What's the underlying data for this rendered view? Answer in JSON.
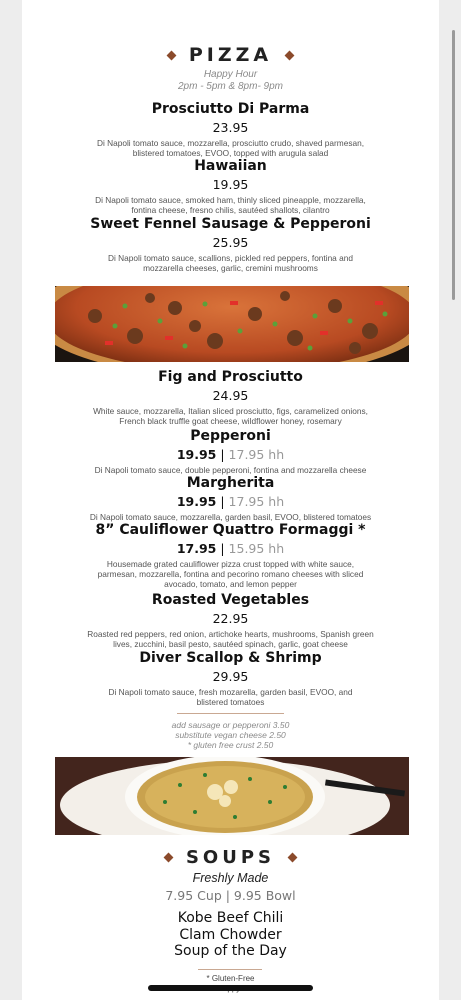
{
  "pizza": {
    "title": "PIZZA",
    "happy_hour_label": "Happy Hour",
    "happy_hour_times": "2pm - 5pm & 8pm- 9pm",
    "items": [
      {
        "name": "Prosciutto Di Parma",
        "price": "23.95",
        "hh_price": "",
        "desc1": "Di Napoli tomato sauce, mozzarella, prosciutto crudo, shaved parmesan,",
        "desc2": "blistered tomatoes, EVOO, topped with arugula salad"
      },
      {
        "name": "Hawaiian",
        "price": "19.95",
        "hh_price": "",
        "desc1": "Di Napoli tomato sauce, smoked ham, thinly sliced pineapple, mozzarella,",
        "desc2": "fontina cheese, fresno chilis, sautéed shallots, cilantro"
      },
      {
        "name": "Sweet Fennel Sausage & Pepperoni",
        "price": "25.95",
        "hh_price": "",
        "desc1": "Di Napoli tomato sauce, scallions, pickled red peppers, fontina and",
        "desc2": "mozzarella cheeses, garlic, cremini mushrooms"
      },
      {
        "name": "Fig and Prosciutto",
        "price": "24.95",
        "hh_price": "",
        "desc1": "White sauce, mozzarella, Italian sliced prosciutto, figs, caramelized onions,",
        "desc2": "French black truffle goat cheese, wildflower honey, rosemary"
      },
      {
        "name": "Pepperoni",
        "price": "19.95",
        "hh_price": "17.95 hh",
        "desc1": "Di Napoli tomato sauce, double pepperoni, fontina and mozzarella cheese",
        "desc2": ""
      },
      {
        "name": "Margherita",
        "price": "19.95",
        "hh_price": "17.95 hh",
        "desc1": "Di Napoli tomato sauce, mozzarella, garden basil, EVOO, blistered tomatoes",
        "desc2": ""
      },
      {
        "name": "8” Cauliflower Quattro Formaggi *",
        "price": "17.95",
        "hh_price": "15.95 hh",
        "desc1": "Housemade grated cauliflower pizza crust topped with white sauce,",
        "desc2": "parmesan, mozzarella, fontina and pecorino romano cheeses with sliced",
        "desc3": "avocado, tomato, and lemon pepper"
      },
      {
        "name": "Roasted Vegetables",
        "price": "22.95",
        "hh_price": "",
        "desc1": "Roasted red peppers, red onion, artichoke hearts, mushrooms, Spanish green",
        "desc2": "lives, zucchini, basil pesto, sautéed spinach, garlic, goat cheese"
      },
      {
        "name": "Diver Scallop & Shrimp",
        "price": "29.95",
        "hh_price": "",
        "desc1": "Di Napoli tomato sauce, fresh mozarella, garden basil, EVOO, and",
        "desc2": "blistered tomatoes"
      }
    ],
    "addons": [
      "add sausage or pepperoni 3.50",
      "substitute vegan cheese 2.50",
      "* gluten free crust 2.50"
    ]
  },
  "price_separator": " | ",
  "soups": {
    "title": "SOUPS",
    "subtitle": "Freshly Made",
    "prices": "7.95 Cup | 9.95 Bowl",
    "items": [
      "Kobe Beef Chili",
      "Clam Chowder",
      "Soup of the Day"
    ]
  },
  "footer": {
    "note1": "* Gluten-Free",
    "note2": "hh - Happy Hour"
  },
  "colors": {
    "accent": "#8b4a2b",
    "muted": "#8a8a8a",
    "hh_price": "#999999"
  }
}
